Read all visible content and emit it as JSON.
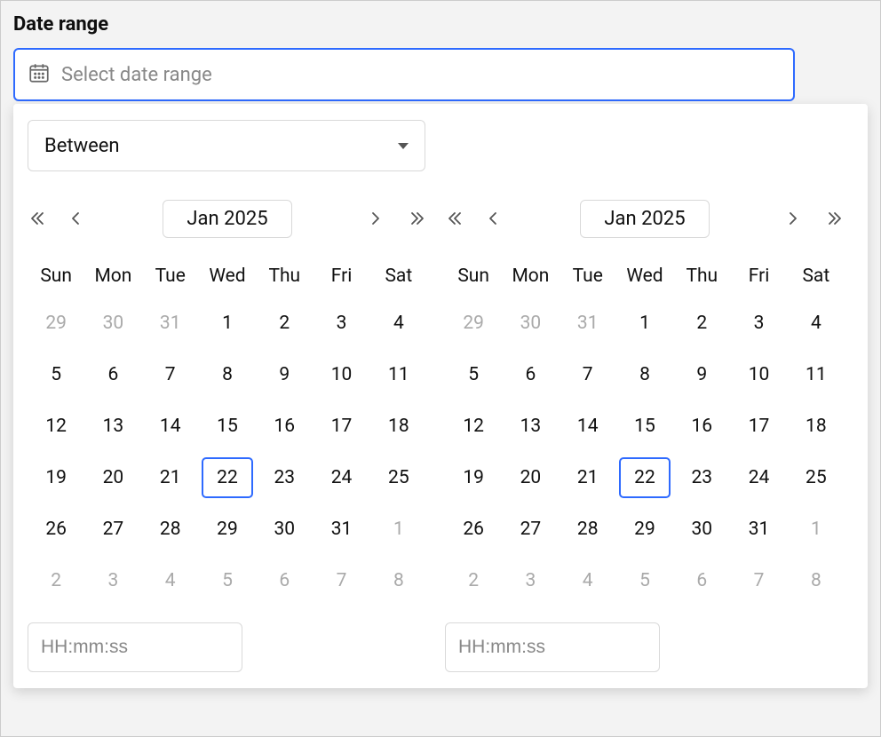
{
  "label": "Date range",
  "input": {
    "placeholder": "Select date range"
  },
  "modeSelect": {
    "value": "Between"
  },
  "weekdays": [
    "Sun",
    "Mon",
    "Tue",
    "Wed",
    "Thu",
    "Fri",
    "Sat"
  ],
  "timePlaceholder": "HH:mm:ss",
  "panes": [
    {
      "monthLabel": "Jan 2025",
      "today": 22,
      "days": [
        {
          "n": 29,
          "out": true
        },
        {
          "n": 30,
          "out": true
        },
        {
          "n": 31,
          "out": true
        },
        {
          "n": 1
        },
        {
          "n": 2
        },
        {
          "n": 3
        },
        {
          "n": 4
        },
        {
          "n": 5
        },
        {
          "n": 6
        },
        {
          "n": 7
        },
        {
          "n": 8
        },
        {
          "n": 9
        },
        {
          "n": 10
        },
        {
          "n": 11
        },
        {
          "n": 12
        },
        {
          "n": 13
        },
        {
          "n": 14
        },
        {
          "n": 15
        },
        {
          "n": 16
        },
        {
          "n": 17
        },
        {
          "n": 18
        },
        {
          "n": 19
        },
        {
          "n": 20
        },
        {
          "n": 21
        },
        {
          "n": 22
        },
        {
          "n": 23
        },
        {
          "n": 24
        },
        {
          "n": 25
        },
        {
          "n": 26
        },
        {
          "n": 27
        },
        {
          "n": 28
        },
        {
          "n": 29
        },
        {
          "n": 30
        },
        {
          "n": 31
        },
        {
          "n": 1,
          "out": true
        },
        {
          "n": 2,
          "out": true
        },
        {
          "n": 3,
          "out": true
        },
        {
          "n": 4,
          "out": true
        },
        {
          "n": 5,
          "out": true
        },
        {
          "n": 6,
          "out": true
        },
        {
          "n": 7,
          "out": true
        },
        {
          "n": 8,
          "out": true
        }
      ]
    },
    {
      "monthLabel": "Jan 2025",
      "today": 22,
      "days": [
        {
          "n": 29,
          "out": true
        },
        {
          "n": 30,
          "out": true
        },
        {
          "n": 31,
          "out": true
        },
        {
          "n": 1
        },
        {
          "n": 2
        },
        {
          "n": 3
        },
        {
          "n": 4
        },
        {
          "n": 5
        },
        {
          "n": 6
        },
        {
          "n": 7
        },
        {
          "n": 8
        },
        {
          "n": 9
        },
        {
          "n": 10
        },
        {
          "n": 11
        },
        {
          "n": 12
        },
        {
          "n": 13
        },
        {
          "n": 14
        },
        {
          "n": 15
        },
        {
          "n": 16
        },
        {
          "n": 17
        },
        {
          "n": 18
        },
        {
          "n": 19
        },
        {
          "n": 20
        },
        {
          "n": 21
        },
        {
          "n": 22
        },
        {
          "n": 23
        },
        {
          "n": 24
        },
        {
          "n": 25
        },
        {
          "n": 26
        },
        {
          "n": 27
        },
        {
          "n": 28
        },
        {
          "n": 29
        },
        {
          "n": 30
        },
        {
          "n": 31
        },
        {
          "n": 1,
          "out": true
        },
        {
          "n": 2,
          "out": true
        },
        {
          "n": 3,
          "out": true
        },
        {
          "n": 4,
          "out": true
        },
        {
          "n": 5,
          "out": true
        },
        {
          "n": 6,
          "out": true
        },
        {
          "n": 7,
          "out": true
        },
        {
          "n": 8,
          "out": true
        }
      ]
    }
  ]
}
